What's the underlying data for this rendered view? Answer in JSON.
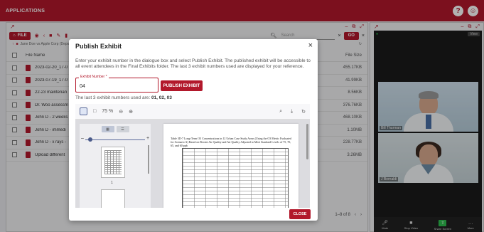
{
  "app": {
    "title": "APPLICATIONS"
  },
  "topbar": {
    "help_glyph": "?",
    "user_glyph": "☺"
  },
  "left_window": {
    "controls": [
      "–",
      "⧉",
      "⤢"
    ],
    "file_label": "FILE",
    "search_placeholder": "Search",
    "go_label": "GO",
    "breadcrumb": "Jane Doe vs Apple Corp (Depo...",
    "columns": {
      "name": "File Name",
      "size": "File Size"
    },
    "files": [
      {
        "name": "2023-02-20_17-0",
        "size": "455.17KB"
      },
      {
        "name": "2023-07-19_17-0",
        "size": "41.99KB"
      },
      {
        "name": "22-23 maintenan",
        "size": "8.56KB"
      },
      {
        "name": "Dr. Woo assessm",
        "size": "376.76KB"
      },
      {
        "name": "John D - 2 weeks",
        "size": "468.10KB"
      },
      {
        "name": "John D - immedi",
        "size": "1.10MB"
      },
      {
        "name": "John D - x rays -",
        "size": "228.77KB"
      },
      {
        "name": "Upload different",
        "size": "3.26MB"
      }
    ],
    "pager": "1–8 of 8"
  },
  "right_window": {
    "view_label": "View",
    "participants": [
      {
        "name": "Bill Thurman"
      },
      {
        "name": "J Bernaldi"
      }
    ],
    "controls": [
      {
        "icon": "●",
        "label": "Mute"
      },
      {
        "icon": "■",
        "label": "Stop Video"
      },
      {
        "icon": "⇧",
        "label": "Share Screen"
      },
      {
        "icon": "…",
        "label": "More"
      }
    ]
  },
  "modal": {
    "title": "Publish Exhibit",
    "close_glyph": "×",
    "description": "Enter your exhibit number in the dialogue box and select Publish Exhibit. The published exhibit will be accessible to all event attendees in the Final Exhibits folder. The last 3 exhibit numbers used are displayed for your reference.",
    "field_label": "Exhibit Number *",
    "field_value": "04",
    "publish_label": "PUBLISH EXHIBIT",
    "last_used_prefix": "The last 3 exhibit numbers used are:",
    "last_used_values": "01, 02, 03",
    "zoom": "75 %",
    "page_number": "1",
    "doc_caption": "Table 3D-7  Long-Term O3 Concentrations in 12 Urban Case Study Areas (Using the O3 Metric Evaluated for Scenario A) Based on Recent Air Quality and Air Quality Adjusted to Meet Standard Levels of 75, 70, 65, and 60 ppb",
    "close_label": "CLOSE"
  },
  "colors": {
    "brand": "#b2182b",
    "success": "#2dbe4e"
  }
}
